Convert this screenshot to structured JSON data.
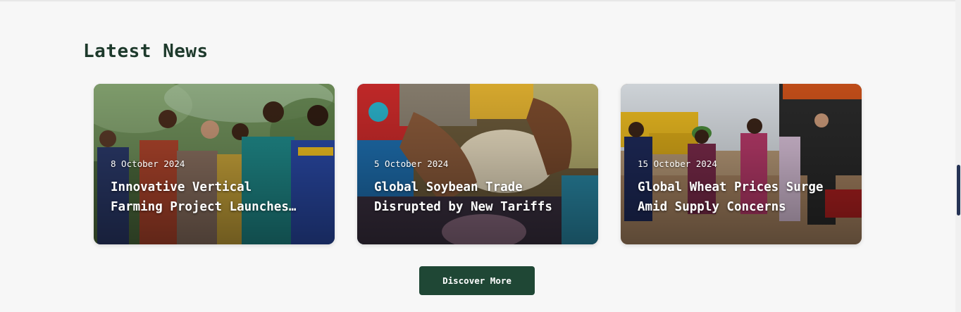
{
  "section": {
    "title": "Latest News"
  },
  "news": [
    {
      "date": "8 October 2024",
      "title_line1": "Innovative Vertical",
      "title_line2": "Farming Project Launches…"
    },
    {
      "date": "5 October 2024",
      "title_line1": "Global Soybean Trade",
      "title_line2": "Disrupted by New Tariffs"
    },
    {
      "date": "15 October 2024",
      "title_line1": "Global Wheat Prices Surge",
      "title_line2": "Amid Supply Concerns"
    }
  ],
  "cta": {
    "label": "Discover More"
  },
  "colors": {
    "accent": "#1f4735",
    "heading": "#1e3a2c",
    "background": "#f7f7f7"
  }
}
